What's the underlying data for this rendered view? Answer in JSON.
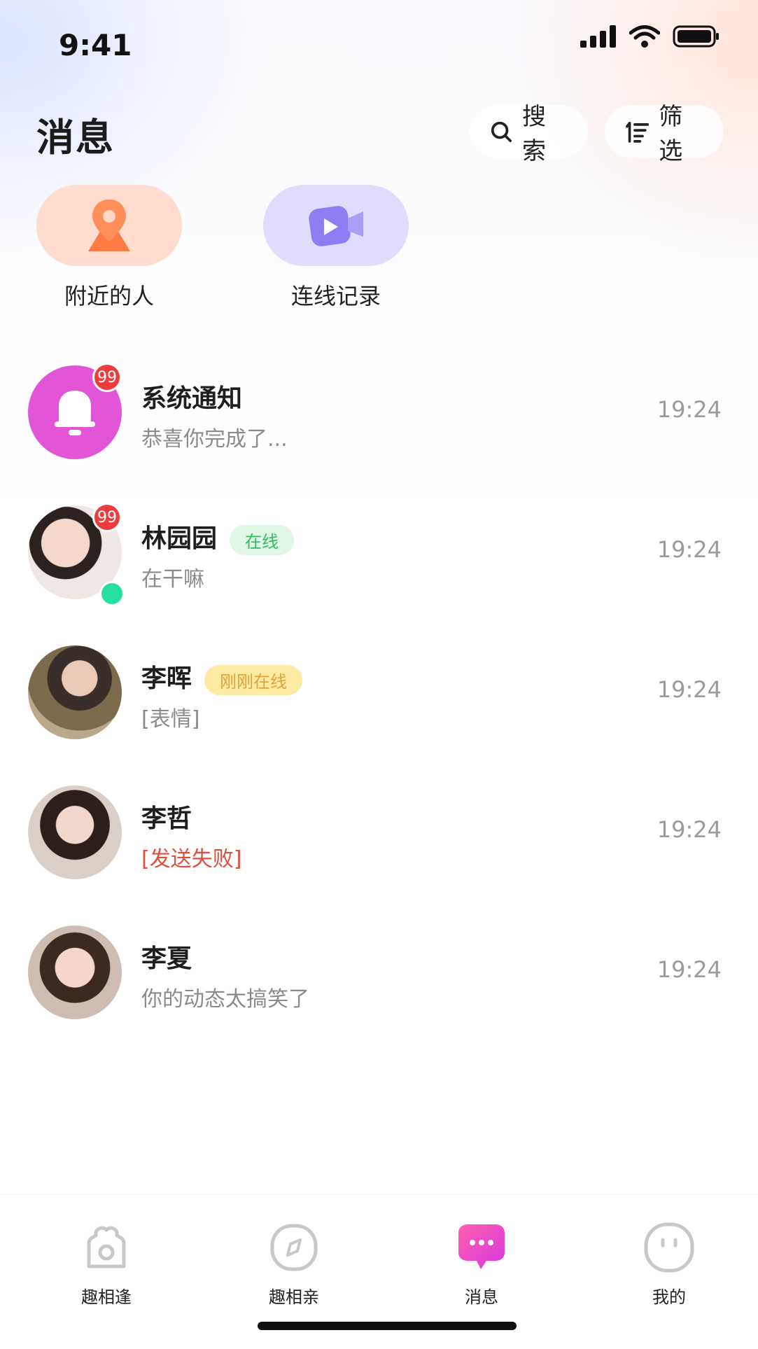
{
  "status": {
    "time": "9:41"
  },
  "header": {
    "title": "消息",
    "search_label": "搜索",
    "filter_label": "筛选"
  },
  "quick": [
    {
      "label": "附近的人",
      "icon": "location-pin-icon",
      "color": "#ffdccd"
    },
    {
      "label": "连线记录",
      "icon": "video-camera-icon",
      "color": "#e0dcfb"
    }
  ],
  "conversations": [
    {
      "name": "系统通知",
      "preview": "恭喜你完成了...",
      "time": "19:24",
      "badge": "99",
      "tag": "",
      "avatar": "bell-icon"
    },
    {
      "name": "林园园",
      "preview": "在干嘛",
      "time": "19:24",
      "badge": "99",
      "tag": "在线",
      "online": true
    },
    {
      "name": "李晖",
      "preview": "[表情]",
      "time": "19:24",
      "badge": "",
      "tag": "刚刚在线"
    },
    {
      "name": "李哲",
      "preview": "[发送失败]",
      "time": "19:24",
      "badge": "",
      "tag": ""
    },
    {
      "name": "李夏",
      "preview": "你的动态太搞笑了",
      "time": "19:24",
      "badge": "",
      "tag": ""
    }
  ],
  "tabs": [
    {
      "label": "趣相逢",
      "icon": "home-icon",
      "active": false
    },
    {
      "label": "趣相亲",
      "icon": "compass-icon",
      "active": false
    },
    {
      "label": "消息",
      "icon": "chat-bubble-icon",
      "active": true
    },
    {
      "label": "我的",
      "icon": "profile-face-icon",
      "active": false
    }
  ],
  "colors": {
    "accent": "#e63fd3",
    "badge": "#ee3b3b",
    "online": "#27e0a1",
    "fail": "#e24d3c"
  }
}
